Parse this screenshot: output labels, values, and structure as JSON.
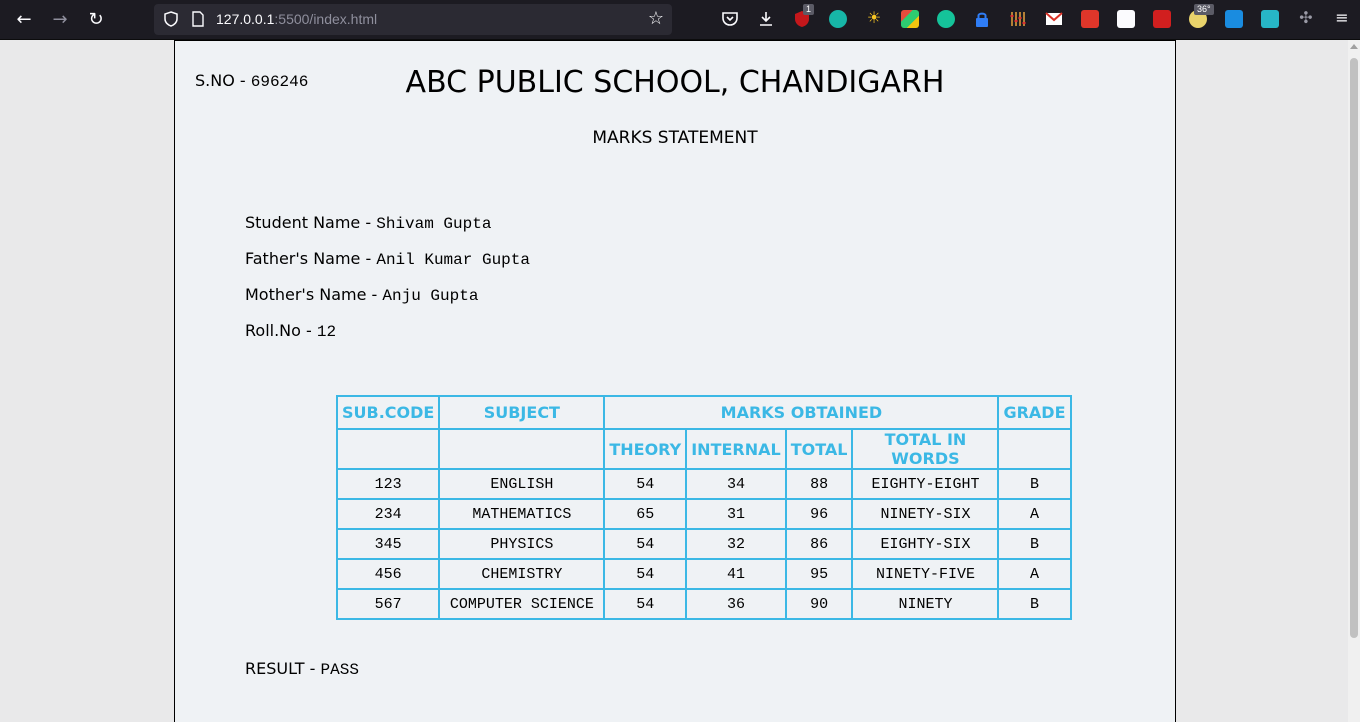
{
  "browser": {
    "url_host": "127.0.0.1",
    "url_rest": ":5500/index.html",
    "badge_count": "1",
    "weather_badge": "36°"
  },
  "document": {
    "sno_label": "S.NO - ",
    "sno_value": "696246",
    "school_name": "ABC PUBLIC SCHOOL, CHANDIGARH",
    "statement_title": "MARKS STATEMENT",
    "student_name_label": "Student Name - ",
    "student_name": "Shivam Gupta",
    "father_name_label": "Father's Name - ",
    "father_name": "Anil Kumar Gupta",
    "mother_name_label": "Mother's Name - ",
    "mother_name": "Anju Gupta",
    "roll_label": "Roll.No - ",
    "roll_value": "12",
    "result_label": "RESULT - ",
    "result_value": "PASS"
  },
  "table": {
    "headers": {
      "sub_code": "SUB.CODE",
      "subject": "SUBJECT",
      "marks_obtained": "MARKS OBTAINED",
      "grade": "GRADE",
      "theory": "THEORY",
      "internal": "INTERNAL",
      "total": "TOTAL",
      "total_in_words": "TOTAL IN WORDS"
    },
    "rows": [
      [
        "123",
        "ENGLISH",
        "54",
        "34",
        "88",
        "EIGHTY-EIGHT",
        "B"
      ],
      [
        "234",
        "MATHEMATICS",
        "65",
        "31",
        "96",
        "NINETY-SIX",
        "A"
      ],
      [
        "345",
        "PHYSICS",
        "54",
        "32",
        "86",
        "EIGHTY-SIX",
        "B"
      ],
      [
        "456",
        "CHEMISTRY",
        "54",
        "41",
        "95",
        "NINETY-FIVE",
        "A"
      ],
      [
        "567",
        "COMPUTER SCIENCE",
        "54",
        "36",
        "90",
        "NINETY",
        "B"
      ]
    ]
  },
  "colors": {
    "table_accent": "#3bb8e5",
    "sheet_bg": "#eff2f5",
    "toolbar_bg": "#1c1b22"
  }
}
